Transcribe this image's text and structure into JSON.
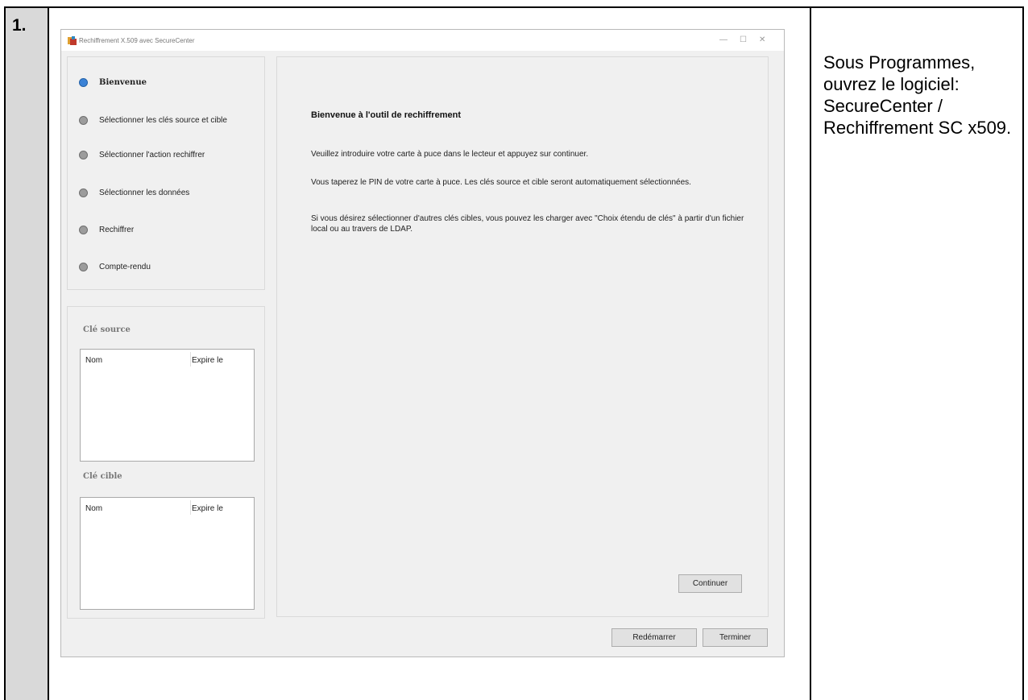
{
  "step_number": "1.",
  "instruction": "Sous Programmes, ouvrez le logiciel: SecureCenter / Rechiffrement SC x509.",
  "window": {
    "title": "Rechiffrement X.509 avec SecureCenter",
    "minimize_icon": "minimize-icon",
    "maximize_icon": "maximize-icon",
    "close_icon": "close-icon"
  },
  "steps": [
    {
      "label": "Bienvenue",
      "active": true
    },
    {
      "label": "Sélectionner les clés source et cible",
      "active": false
    },
    {
      "label": "Sélectionner l'action rechiffrer",
      "active": false
    },
    {
      "label": "Sélectionner les données",
      "active": false
    },
    {
      "label": "Rechiffrer",
      "active": false
    },
    {
      "label": "Compte-rendu",
      "active": false
    }
  ],
  "source_key": {
    "title": "Clé source",
    "columns": [
      "Nom",
      "Expire le"
    ]
  },
  "target_key": {
    "title": "Clé cible",
    "columns": [
      "Nom",
      "Expire le"
    ]
  },
  "main": {
    "title": "Bienvenue à l'outil de rechiffrement",
    "paragraphs": [
      "Veuillez introduire votre carte à puce dans le lecteur et appuyez sur continuer.",
      "Vous taperez le PIN de votre carte à puce. Les clés source et cible seront automatiquement sélectionnées.",
      "Si vous désirez sélectionner d'autres clés cibles, vous pouvez les charger avec  \"Choix étendu de clés\" à partir d'un fichier local ou au travers de LDAP."
    ],
    "continue_label": "Continuer"
  },
  "footer": {
    "restart_label": "Redémarrer",
    "finish_label": "Terminer"
  },
  "colors": {
    "active_step": "#3b82d6",
    "inactive_step": "#9c9c9c",
    "number_column": "#d9d9d9"
  }
}
